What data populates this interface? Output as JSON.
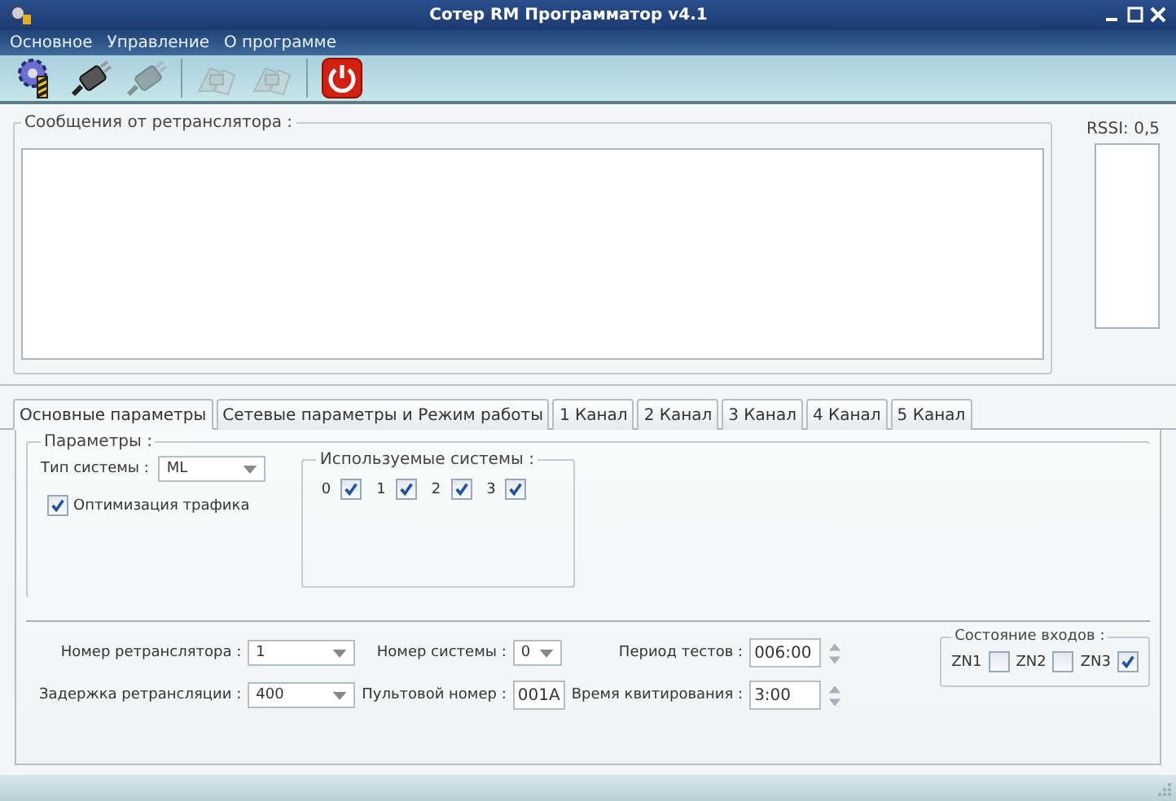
{
  "window": {
    "title": "Сотер RM Программатор v4.1"
  },
  "menu": [
    "Основное",
    "Управление",
    "О программе"
  ],
  "toolbar": [
    {
      "kind": "gear",
      "disabled": false
    },
    {
      "kind": "plug",
      "disabled": false
    },
    {
      "kind": "plug",
      "disabled": true
    },
    {
      "kind": "hands",
      "disabled": true
    },
    {
      "kind": "hands",
      "disabled": true
    },
    {
      "kind": "power",
      "disabled": false
    }
  ],
  "messages": {
    "label": "Сообщения от ретранслятора :"
  },
  "rssi": {
    "label": "RSSI: 0,5"
  },
  "tabs": [
    {
      "label": "Основные параметры",
      "selected": true
    },
    {
      "label": "Сетевые параметры и Режим работы",
      "selected": false
    },
    {
      "label": "1 Канал",
      "selected": false
    },
    {
      "label": "2 Канал",
      "selected": false
    },
    {
      "label": "3 Канал",
      "selected": false
    },
    {
      "label": "4 Канал",
      "selected": false
    },
    {
      "label": "5 Канал",
      "selected": false
    }
  ],
  "params": {
    "legend": "Параметры :",
    "system_type": {
      "label": "Тип системы :",
      "value": "ML"
    },
    "traffic_optimization": {
      "label": "Оптимизация трафика",
      "checked": true
    }
  },
  "used_systems": {
    "legend": "Используемые системы :",
    "items": [
      {
        "label": "0",
        "checked": true
      },
      {
        "label": "1",
        "checked": true
      },
      {
        "label": "2",
        "checked": true
      },
      {
        "label": "3",
        "checked": true
      }
    ]
  },
  "fields": [
    {
      "label": "Номер ретранслятора :",
      "kind": "combo",
      "value": "1"
    },
    {
      "label": "Номер системы :",
      "kind": "combo-narrow",
      "value": "0"
    },
    {
      "label": "Период тестов :",
      "kind": "spin",
      "value": "006:00"
    },
    {
      "label": "Задержка ретрансляции :",
      "kind": "combo",
      "value": "400"
    },
    {
      "label": "Пультовой номер :",
      "kind": "text",
      "value": "001A"
    },
    {
      "label": "Время квитирования :",
      "kind": "spin",
      "value": "3:00"
    }
  ],
  "input_states": {
    "legend": "Состояние входов :",
    "items": [
      {
        "label": "ZN1",
        "checked": false
      },
      {
        "label": "ZN2",
        "checked": false
      },
      {
        "label": "ZN3",
        "checked": true
      }
    ]
  }
}
